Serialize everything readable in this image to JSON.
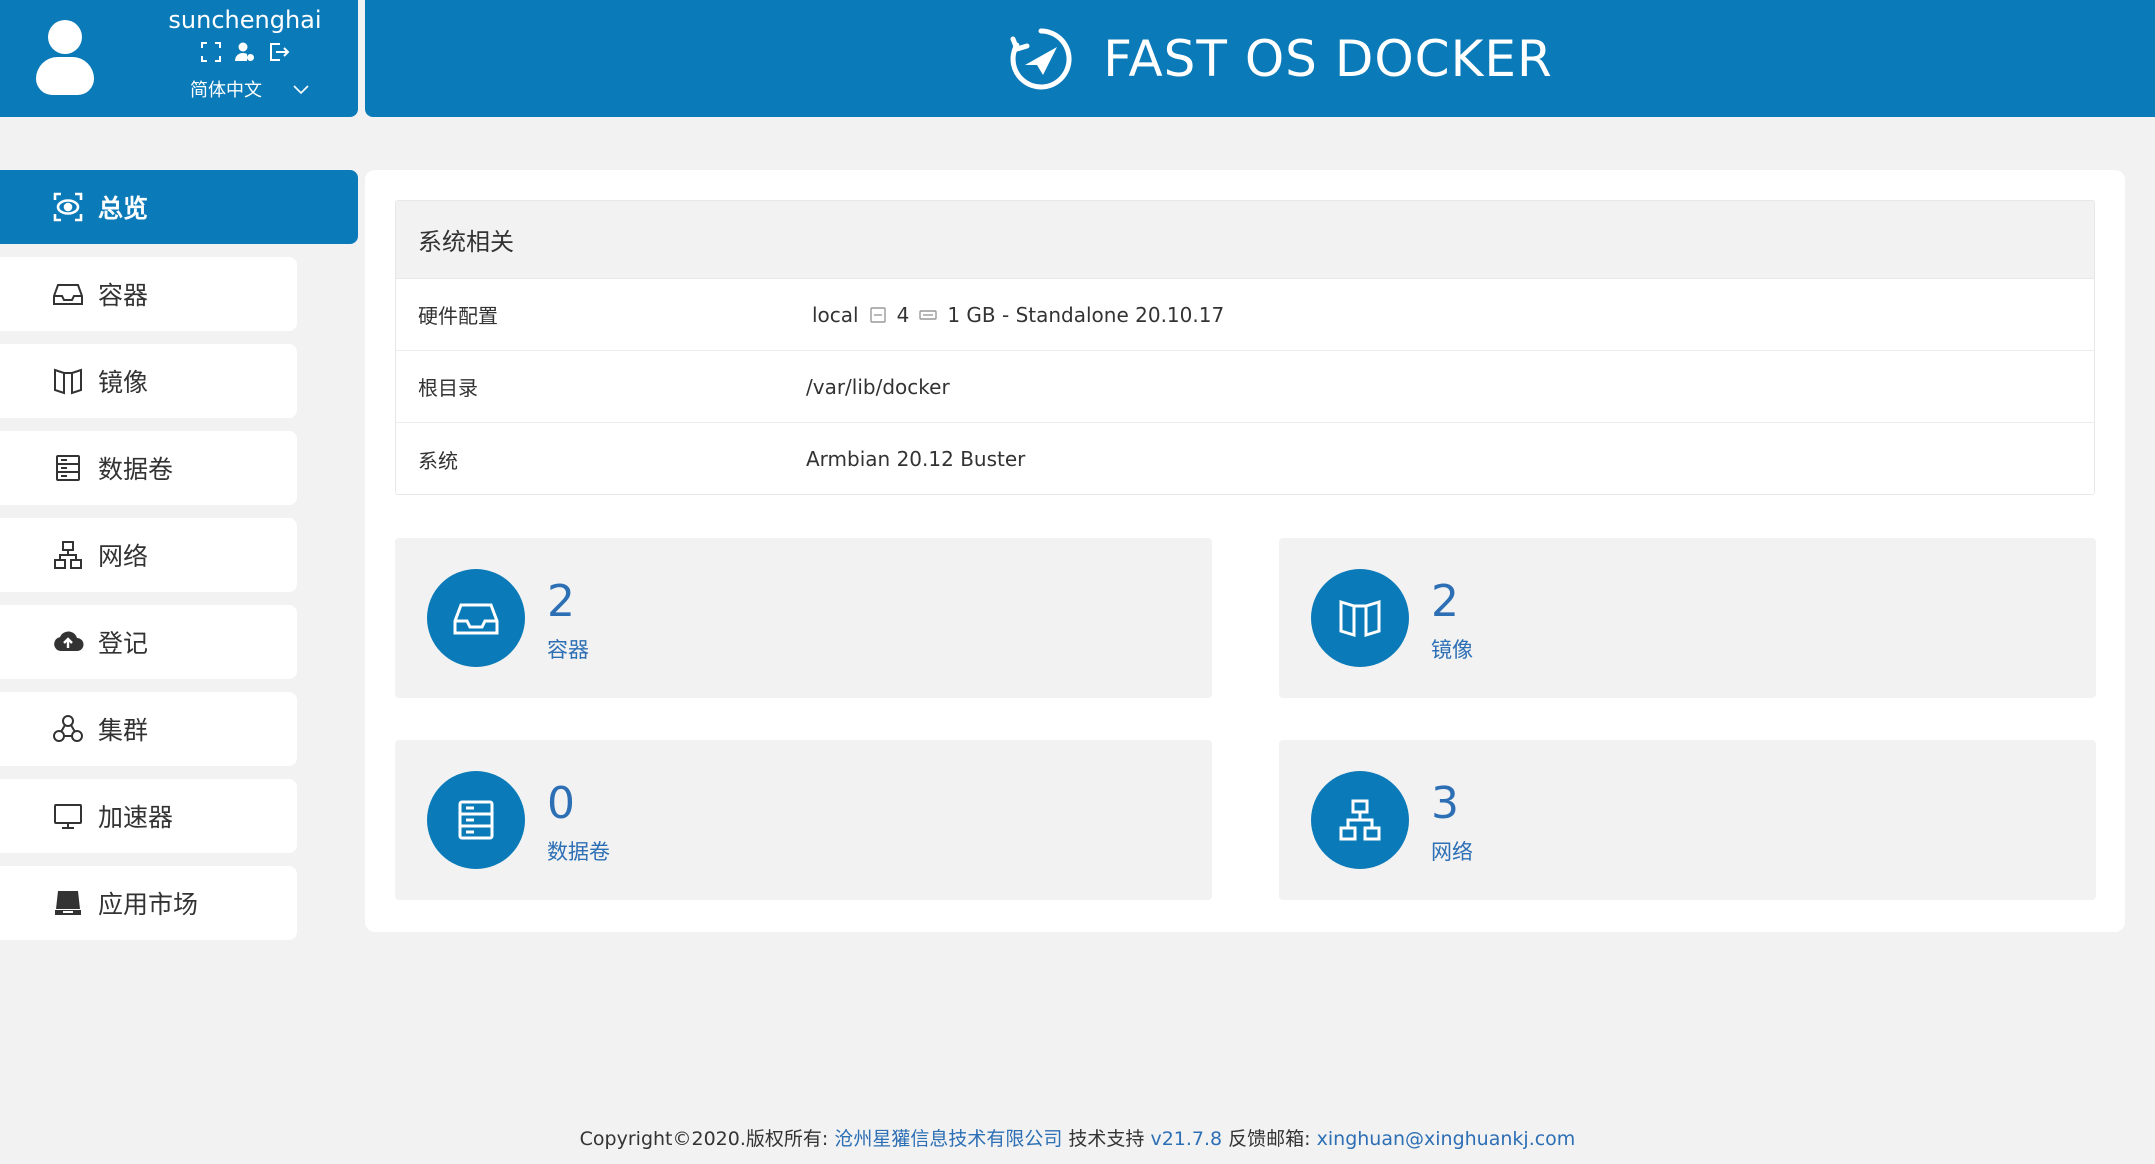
{
  "user": {
    "username": "sunchenghai",
    "language": "简体中文",
    "tools": [
      "fullscreen-icon",
      "user-settings-icon",
      "logout-icon"
    ]
  },
  "header": {
    "title": "FAST OS DOCKER",
    "logo_icon": "fast-os-logo-icon",
    "color": "#0b7ab8"
  },
  "sidebar": {
    "items": [
      {
        "label": "总览",
        "icon": "dashboard-eye-icon",
        "active": true
      },
      {
        "label": "容器",
        "icon": "inbox-icon"
      },
      {
        "label": "镜像",
        "icon": "image-book-icon"
      },
      {
        "label": "数据卷",
        "icon": "database-icon"
      },
      {
        "label": "网络",
        "icon": "network-icon"
      },
      {
        "label": "登记",
        "icon": "cloud-upload-icon"
      },
      {
        "label": "集群",
        "icon": "cluster-icon"
      },
      {
        "label": "加速器",
        "icon": "monitor-icon"
      },
      {
        "label": "应用市场",
        "icon": "app-store-icon"
      }
    ]
  },
  "system": {
    "title": "系统相关",
    "rows": [
      {
        "label": "硬件配置",
        "host": "local",
        "cpu": "4",
        "memory": "1 GB - Standalone 20.10.17"
      },
      {
        "label": "根目录",
        "value": "/var/lib/docker"
      },
      {
        "label": "系统",
        "value": "Armbian 20.12 Buster"
      }
    ]
  },
  "stats": {
    "containers": {
      "count": "2",
      "label": "容器",
      "icon": "inbox-icon"
    },
    "images": {
      "count": "2",
      "label": "镜像",
      "icon": "image-book-icon"
    },
    "volumes": {
      "count": "0",
      "label": "数据卷",
      "icon": "database-icon"
    },
    "networks": {
      "count": "3",
      "label": "网络",
      "icon": "network-icon"
    }
  },
  "footer": {
    "prefix": "Copyright©2020.版权所有: ",
    "company": "沧州星獾信息技术有限公司",
    "support_label": " 技术支持 ",
    "version": "v21.7.8",
    "email_label": " 反馈邮箱: ",
    "email": "xinghuan@xinghuankj.com"
  }
}
